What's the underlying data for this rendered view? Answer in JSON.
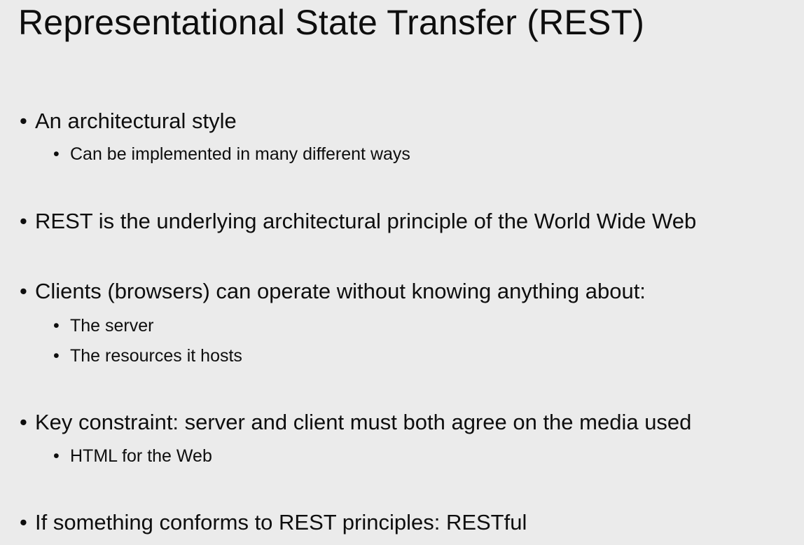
{
  "slide": {
    "title": "Representational State Transfer (REST)",
    "bullet_char": "•",
    "bullets": [
      {
        "text": "An architectural style",
        "sub": [
          "Can be implemented in many different ways"
        ]
      },
      {
        "text": "REST is the underlying architectural principle of the World Wide Web",
        "sub": []
      },
      {
        "text": "Clients (browsers) can operate without knowing anything about:",
        "sub": [
          "The server",
          "The resources it hosts"
        ]
      },
      {
        "text": "Key constraint: server and client must both agree on the media used",
        "sub": [
          "HTML for the Web"
        ]
      },
      {
        "text": "If something conforms to REST principles: RESTful",
        "sub": []
      }
    ]
  },
  "colors": {
    "background": "#ebebeb",
    "text": "#0e0e0e"
  }
}
